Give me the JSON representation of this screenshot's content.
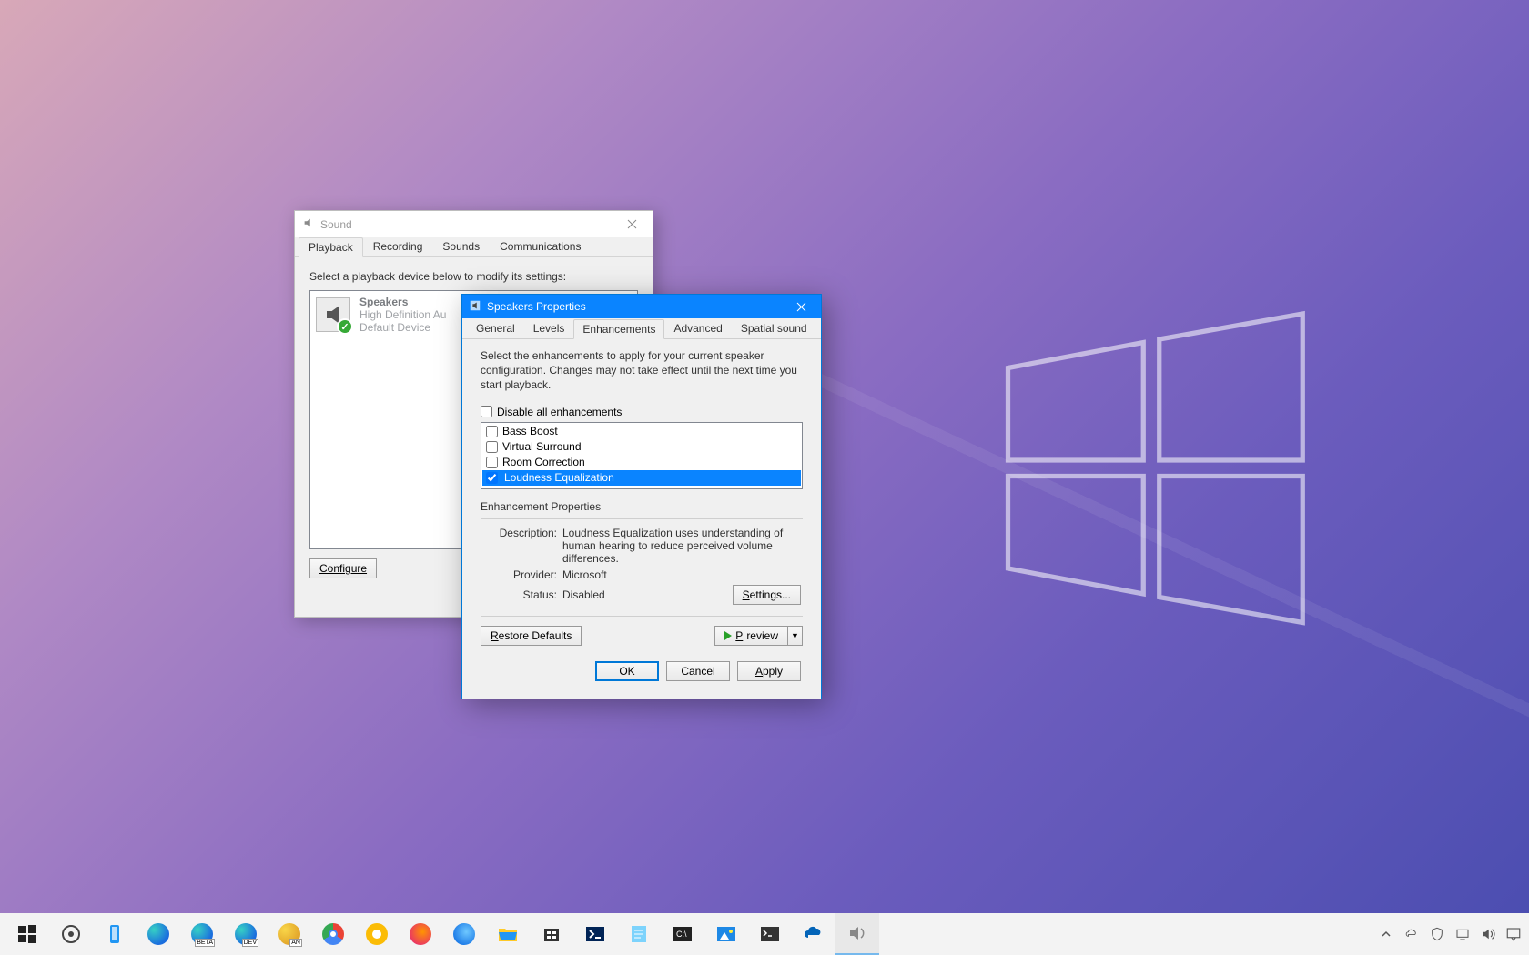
{
  "soundDlg": {
    "title": "Sound",
    "tabs": {
      "playback": "Playback",
      "recording": "Recording",
      "sounds": "Sounds",
      "comm": "Communications"
    },
    "instr": "Select a playback device below to modify its settings:",
    "device": {
      "name": "Speakers",
      "line2": "High Definition Au",
      "line3": "Default Device"
    },
    "configure": "Configure"
  },
  "propDlg": {
    "title": "Speakers Properties",
    "tabs": {
      "general": "General",
      "levels": "Levels",
      "enh": "Enhancements",
      "adv": "Advanced",
      "spatial": "Spatial sound"
    },
    "instr": "Select the enhancements to apply for your current speaker configuration. Changes may not take effect until the next time you start playback.",
    "disableAll": "Disable all enhancements",
    "enh": {
      "bass": "Bass Boost",
      "vs": "Virtual Surround",
      "rc": "Room Correction",
      "le": "Loudness Equalization"
    },
    "propsHdr": "Enhancement Properties",
    "descLabel": "Description:",
    "desc": "Loudness Equalization uses understanding of human hearing to reduce perceived volume differences.",
    "providerLabel": "Provider:",
    "provider": "Microsoft",
    "statusLabel": "Status:",
    "status": "Disabled",
    "settings": "Settings...",
    "restore": "Restore Defaults",
    "preview": "Preview",
    "ok": "OK",
    "cancel": "Cancel",
    "apply": "Apply"
  }
}
